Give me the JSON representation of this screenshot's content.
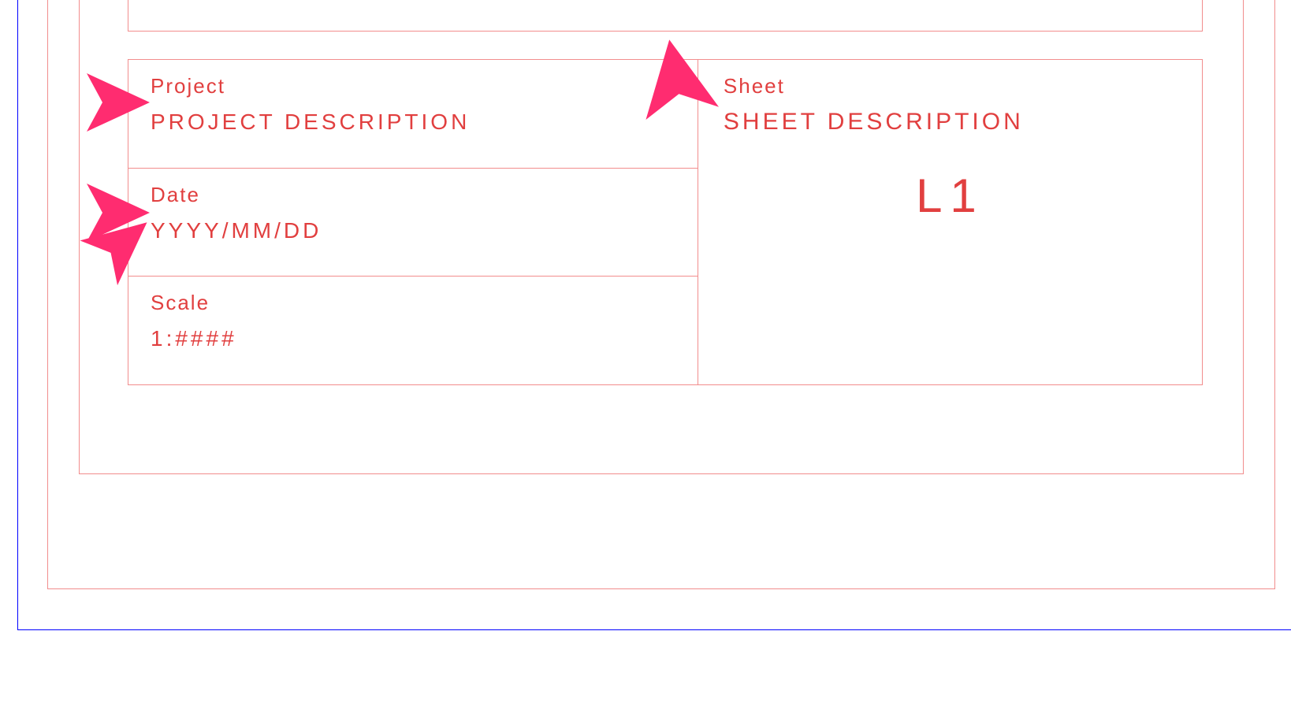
{
  "title_block": {
    "project": {
      "label": "Project",
      "value": "PROJECT DESCRIPTION"
    },
    "date": {
      "label": "Date",
      "value": "YYYY/MM/DD"
    },
    "scale": {
      "label": "Scale",
      "value": "1:####"
    },
    "sheet": {
      "label": "Sheet",
      "description": "SHEET DESCRIPTION",
      "code": "L1"
    }
  },
  "colors": {
    "text": "#e13f3f",
    "border_light": "#f28d8d",
    "page_border": "#0000ff",
    "annotation": "#ff2c70"
  }
}
